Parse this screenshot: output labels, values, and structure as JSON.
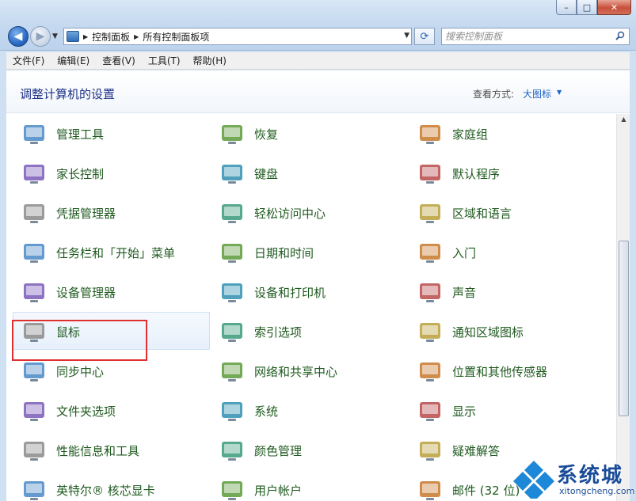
{
  "window": {
    "min_label": "–",
    "max_label": "□",
    "close_label": "✕"
  },
  "nav": {
    "back_label": "◀",
    "forward_label": "▶",
    "breadcrumbs": [
      "控制面板",
      "所有控制面板项"
    ],
    "crumb_separator": "▶",
    "refresh_label": "⟳",
    "search_placeholder": "搜索控制面板"
  },
  "menu": [
    "文件(F)",
    "编辑(E)",
    "查看(V)",
    "工具(T)",
    "帮助(H)"
  ],
  "header": {
    "title": "调整计算机的设置",
    "view_by_label": "查看方式:",
    "view_by_value": "大图标",
    "view_by_caret": "▼"
  },
  "items": [
    [
      "管理工具",
      "恢复",
      "家庭组"
    ],
    [
      "家长控制",
      "键盘",
      "默认程序"
    ],
    [
      "凭据管理器",
      "轻松访问中心",
      "区域和语言"
    ],
    [
      "任务栏和「开始」菜单",
      "日期和时间",
      "入门"
    ],
    [
      "设备管理器",
      "设备和打印机",
      "声音"
    ],
    [
      "鼠标",
      "索引选项",
      "通知区域图标"
    ],
    [
      "同步中心",
      "网络和共享中心",
      "位置和其他传感器"
    ],
    [
      "文件夹选项",
      "系统",
      "显示"
    ],
    [
      "性能信息和工具",
      "颜色管理",
      "疑难解答"
    ]
  ],
  "partial_row": [
    "英特尔® 核芯显卡",
    "用户帐户",
    "邮件 (32 位)"
  ],
  "selected_item": "鼠标",
  "watermark": {
    "text": "系统城",
    "sub": "xitongcheng.com"
  },
  "colors": {
    "item_text": "#1f5a1f",
    "title_text": "#1e3287",
    "link_blue": "#1e64c8",
    "highlight": "#e02f2f"
  }
}
